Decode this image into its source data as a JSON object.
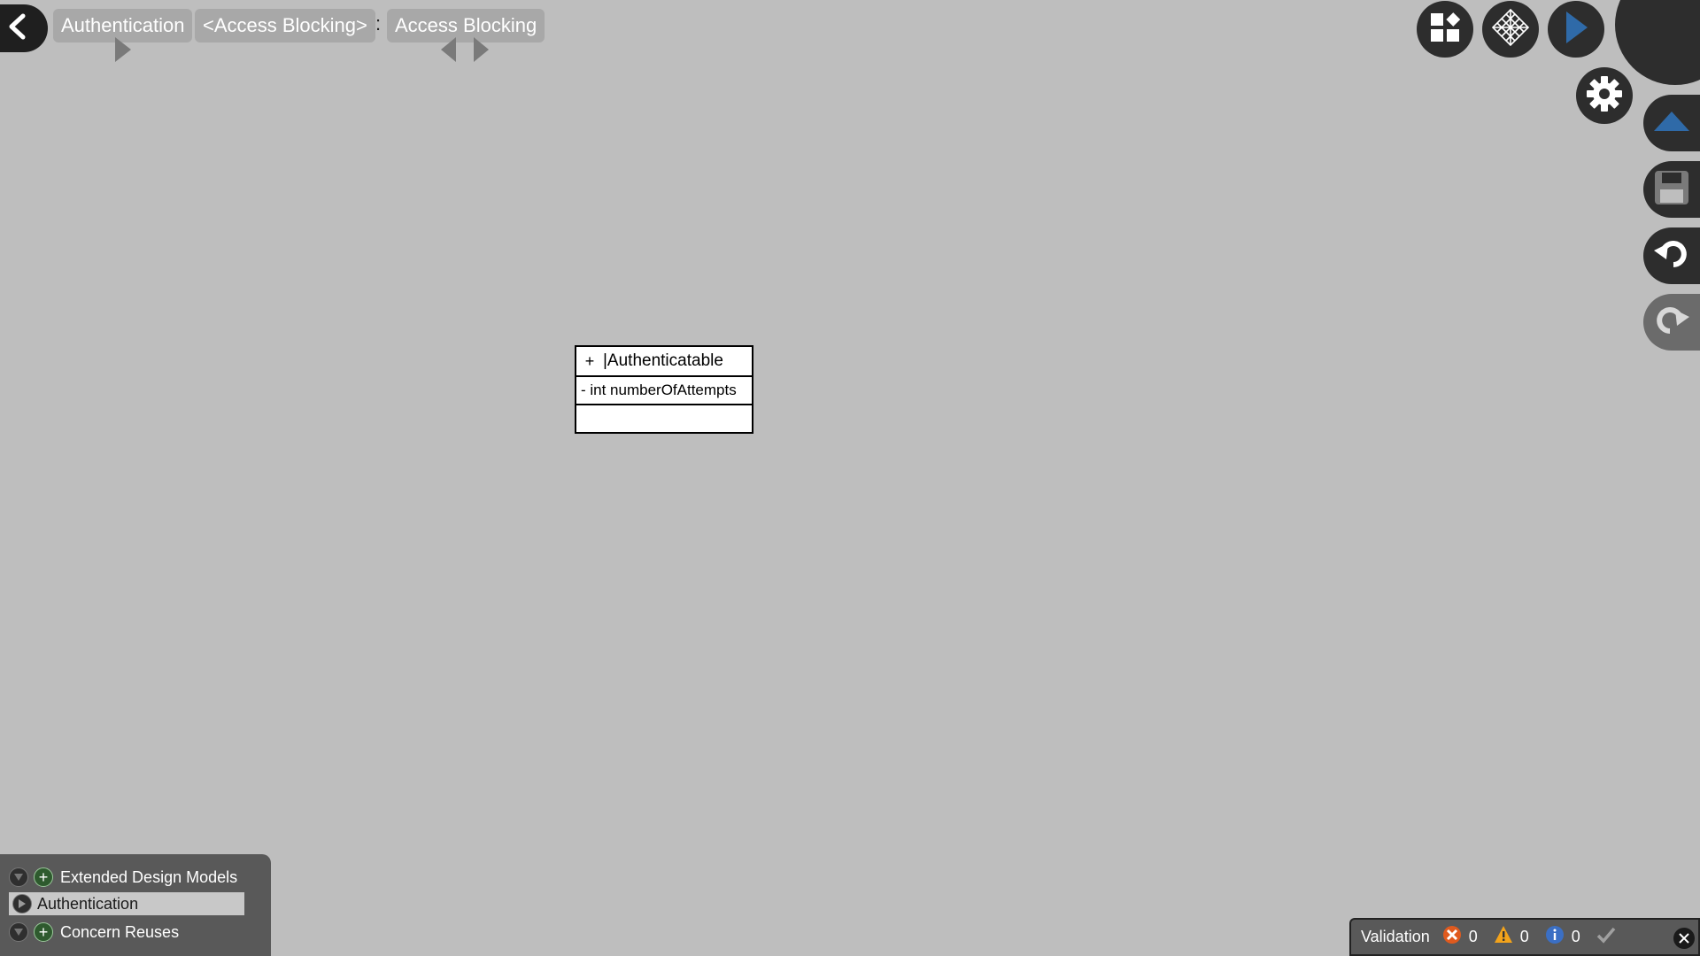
{
  "breadcrumb": {
    "items": [
      {
        "label": "Authentication"
      },
      {
        "label": "<Access Blocking>"
      },
      {
        "label": "Access Blocking"
      }
    ],
    "separator": ":"
  },
  "toolbar": {
    "buttons": [
      {
        "name": "layout",
        "icon": "grid-layout-icon"
      },
      {
        "name": "pattern",
        "icon": "mesh-pattern-icon"
      },
      {
        "name": "play",
        "icon": "play-icon"
      },
      {
        "name": "settings",
        "icon": "gear-icon"
      },
      {
        "name": "collapse",
        "icon": "chevron-up-icon"
      },
      {
        "name": "save",
        "icon": "save-icon"
      },
      {
        "name": "undo",
        "icon": "undo-icon"
      },
      {
        "name": "redo",
        "icon": "redo-icon"
      }
    ],
    "accent": "#2f6aa8"
  },
  "class_box": {
    "visibility": "+",
    "name": "|Authenticatable",
    "attribute": "- int numberOfAttempts"
  },
  "tree": {
    "items": [
      {
        "label": "Extended Design Models",
        "expanded": true,
        "addable": true
      },
      {
        "label": "Authentication",
        "selected": true
      },
      {
        "label": "Concern Reuses",
        "expanded": true,
        "addable": true
      }
    ]
  },
  "validation": {
    "label": "Validation",
    "errors": "0",
    "warnings": "0",
    "infos": "0",
    "colors": {
      "error": "#e05a1e",
      "warning": "#f3a31b",
      "info": "#3b6fc4"
    }
  }
}
